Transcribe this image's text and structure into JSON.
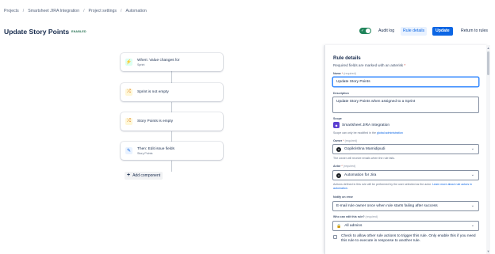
{
  "breadcrumb": {
    "items": [
      "Projects",
      "Smartsheet JIRA Integration",
      "Project settings",
      "Automation"
    ],
    "separator": "/"
  },
  "header": {
    "title": "Update Story Points",
    "status": "ENABLED",
    "toggle_on": true,
    "audit_log": "Audit log",
    "rule_details": "Rule details",
    "update": "Update",
    "return_to_rules": "Return to rules"
  },
  "canvas": {
    "components": [
      {
        "kind": "trigger",
        "icon": "lightning-icon",
        "title": "When: Value changes for",
        "subtitle": "Sprint"
      },
      {
        "kind": "condition",
        "icon": "branch-icon",
        "title": "Sprint is not empty",
        "subtitle": ""
      },
      {
        "kind": "condition",
        "icon": "branch-icon",
        "title": "Story Points is empty",
        "subtitle": ""
      },
      {
        "kind": "action",
        "icon": "pencil-icon",
        "title": "Then: Edit issue fields",
        "subtitle": "Story Points"
      }
    ],
    "add_component": "Add component"
  },
  "panel": {
    "title": "Rule details",
    "required_note": "Required fields are marked with an asterisk",
    "asterisk": "*",
    "name_label": "Name",
    "required_tag": "(required)",
    "name_value": "Update Story Points",
    "description_label": "Description",
    "description_value": "Update Story Points when assigned to a Sprint",
    "scope_label": "Scope",
    "scope_value": "Smartsheet JIRA Integration",
    "scope_helper": "Scope can only be modified in the",
    "scope_link": "global administration",
    "owner_label": "Owner",
    "owner_value": "Gopikrishna Mamidipudi",
    "owner_helper": "The owner will receive emails when the rule fails.",
    "actor_label": "Actor",
    "actor_value": "Automation for Jira",
    "actor_helper": "Actions defined in this rule will be performed by the user selected as the actor.",
    "actor_link": "Learn more about rule actors in automation.",
    "notify_label": "Notify on error",
    "notify_value": "E-mail rule owner once when rule starts failing after success",
    "editors_label": "Who can edit this rule?",
    "editors_value": "All admins",
    "allow_other_rules": "Check to allow other rule actions to trigger this rule. Only enable this if you need this rule to execute in response to another rule."
  }
}
